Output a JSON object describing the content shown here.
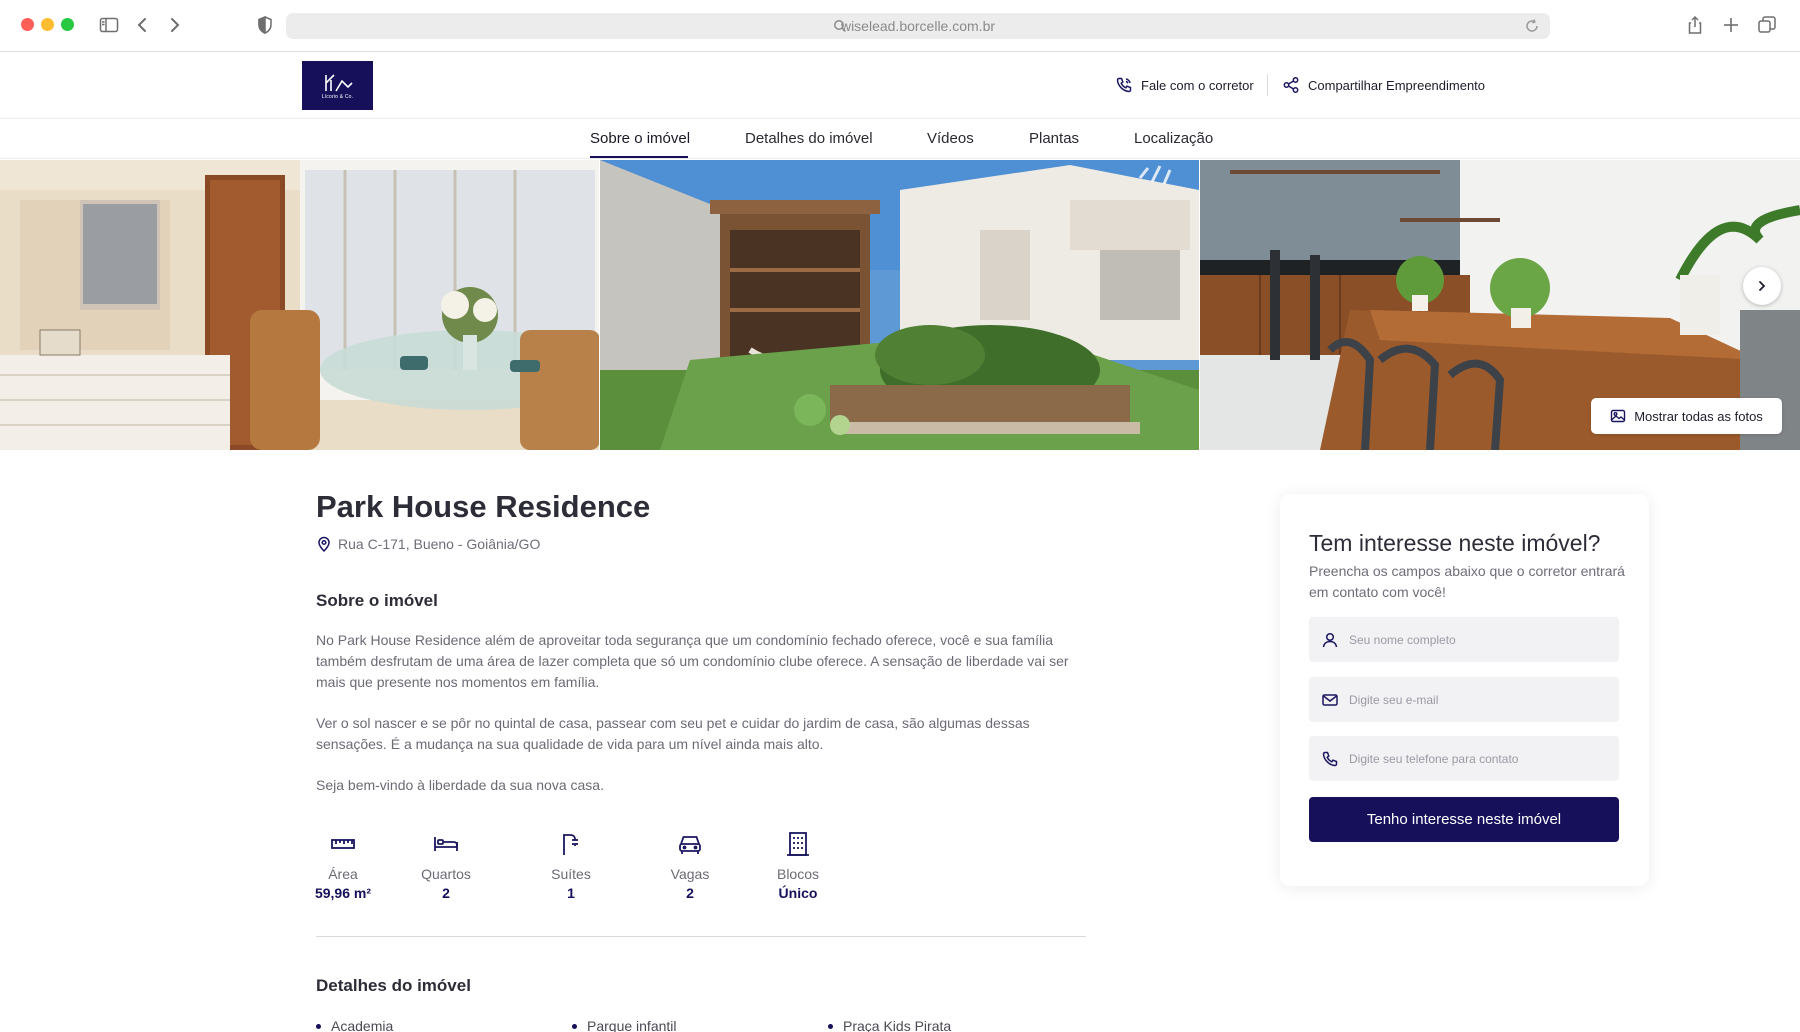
{
  "browser": {
    "url": "wiselead.borcelle.com.br"
  },
  "header": {
    "logo_text": "Lícorio & Co.",
    "contact_label": "Fale com o corretor",
    "share_label": "Compartilhar Empreendimento"
  },
  "nav": {
    "items": [
      {
        "label": "Sobre o imóvel",
        "active": true
      },
      {
        "label": "Detalhes do imóvel",
        "active": false
      },
      {
        "label": "Vídeos",
        "active": false
      },
      {
        "label": "Plantas",
        "active": false
      },
      {
        "label": "Localização",
        "active": false
      }
    ]
  },
  "gallery": {
    "show_all_label": "Mostrar todas as fotos"
  },
  "property": {
    "title": "Park House Residence",
    "address": "Rua C-171, Bueno - Goiânia/GO",
    "about_heading": "Sobre o imóvel",
    "paragraphs": [
      "No Park House Residence além de aproveitar toda segurança que um condomínio fechado oferece, você e sua família também desfrutam de uma área de lazer completa que só um condomínio clube oferece. A sensação de liberdade vai ser mais que presente nos momentos em família.",
      "Ver o sol nascer e se pôr no quintal de casa, passear com seu pet e cuidar do jardim de casa, são algumas dessas sensações. É a mudança na sua qualidade de vida para um nível ainda mais alto.",
      "Seja bem-vindo à liberdade da sua nova casa."
    ],
    "features": [
      {
        "label": "Área",
        "value": "59,96 m²",
        "icon": "ruler-icon"
      },
      {
        "label": "Quartos",
        "value": "2",
        "icon": "bed-icon"
      },
      {
        "label": "Suítes",
        "value": "1",
        "icon": "shower-icon"
      },
      {
        "label": "Vagas",
        "value": "2",
        "icon": "car-icon"
      },
      {
        "label": "Blocos",
        "value": "Único",
        "icon": "building-icon"
      }
    ],
    "details_heading": "Detalhes do imóvel",
    "amenities": [
      "Academia",
      "Parque infantil",
      "Praça Kids Pirata"
    ]
  },
  "form": {
    "title": "Tem interesse neste imóvel?",
    "subtitle": "Preencha os campos abaixo que o corretor entrará em contato com você!",
    "name_placeholder": "Seu nome completo",
    "email_placeholder": "Digite seu e-mail",
    "phone_placeholder": "Digite seu telefone para contato",
    "submit_label": "Tenho interesse neste imóvel"
  },
  "colors": {
    "brand": "#16105a",
    "text": "#2d2d38",
    "muted": "#6b6b75",
    "field_bg": "#f2f2f4"
  }
}
